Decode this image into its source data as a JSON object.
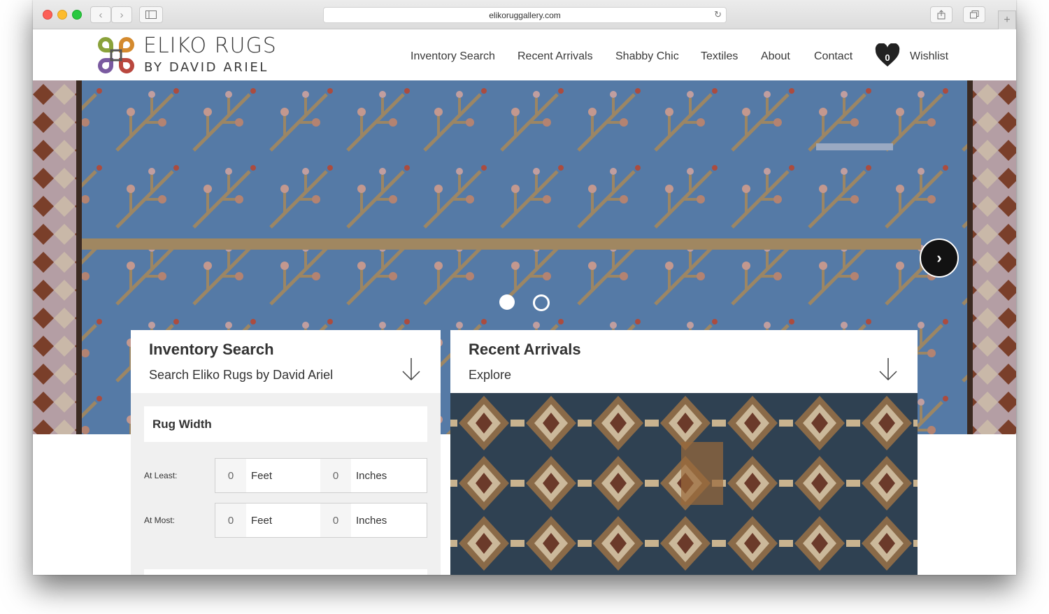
{
  "browser": {
    "url": "elikoruggallery.com",
    "back_icon": "chevron-left-icon",
    "forward_icon": "chevron-right-icon",
    "sidebar_icon": "sidebar-icon",
    "share_icon": "share-icon",
    "tabs_icon": "tabs-icon",
    "newtab_icon": "plus-icon",
    "reload_icon": "reload-icon"
  },
  "logo": {
    "line1": "ELIKO RUGS",
    "line2": "BY DAVID ARIEL"
  },
  "nav": {
    "items": [
      "Inventory Search",
      "Recent Arrivals",
      "Shabby Chic",
      "Textiles",
      "About",
      "Contact"
    ],
    "wishlist_label": "Wishlist",
    "wishlist_count": "0"
  },
  "hero": {
    "slides": 2,
    "active_slide": 1,
    "next_icon": "chevron-right-icon"
  },
  "inventory_panel": {
    "title": "Inventory Search",
    "subtitle": "Search Eliko Rugs by David Ariel",
    "arrow_icon": "arrow-down-icon",
    "width_section": "Rug Width",
    "rows": [
      {
        "label": "At Least:",
        "feet_value": "0",
        "feet_unit": "Feet",
        "inches_value": "0",
        "inches_unit": "Inches"
      },
      {
        "label": "At Most:",
        "feet_value": "0",
        "feet_unit": "Feet",
        "inches_value": "0",
        "inches_unit": "Inches"
      }
    ]
  },
  "recent_panel": {
    "title": "Recent Arrivals",
    "subtitle": "Explore",
    "arrow_icon": "arrow-down-icon"
  },
  "colors": {
    "accent_dark": "#333333",
    "rug_blue": "#4f74a0",
    "rug_tan": "#a08761"
  }
}
